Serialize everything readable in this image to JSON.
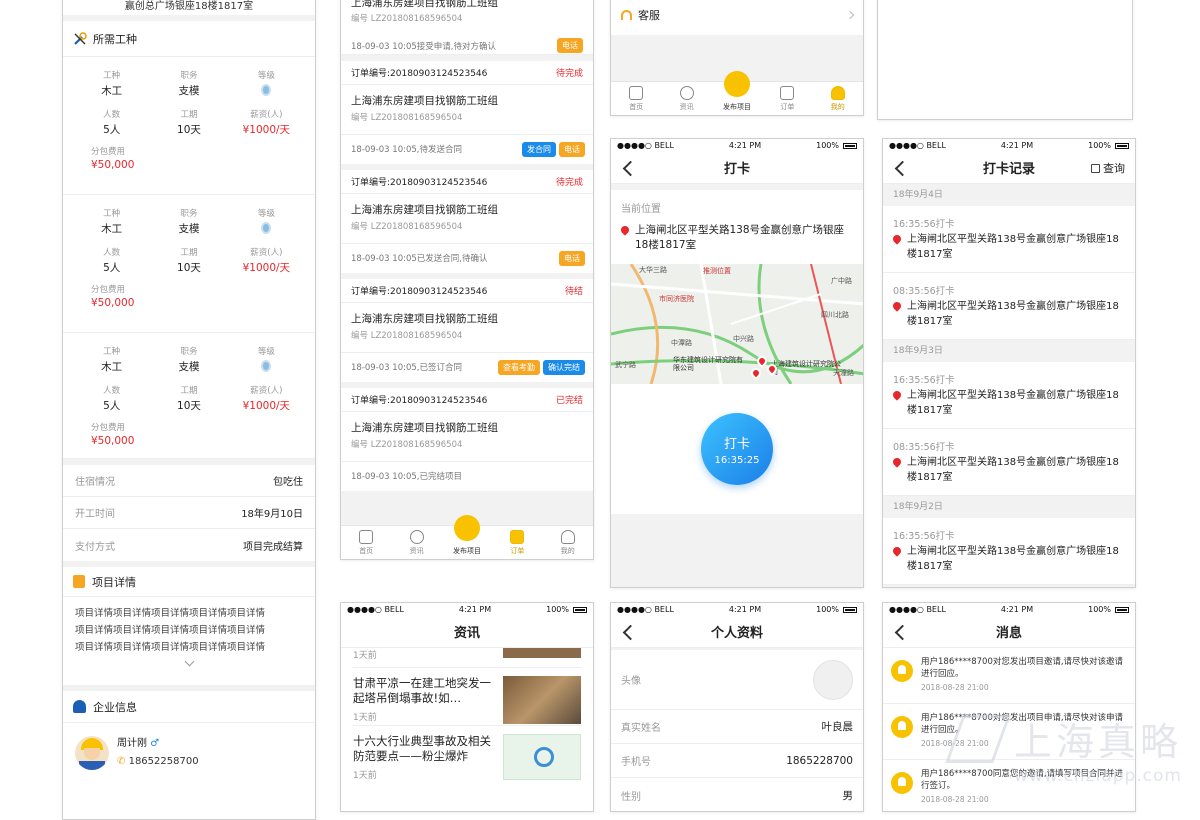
{
  "p1": {
    "top_text": "赢创总广场银座18楼1817室",
    "section1_title": "所需工种",
    "labels": {
      "type": "工种",
      "pos": "职务",
      "level": "等级",
      "people": "人数",
      "period": "工期",
      "salary": "薪资(人)",
      "sub_fee": "分包费用"
    },
    "groups": [
      {
        "type": "木工",
        "pos": "支模",
        "people": "5人",
        "period": "10天",
        "salary": "¥1000/天",
        "fee": "¥50,000"
      },
      {
        "type": "木工",
        "pos": "支模",
        "people": "5人",
        "period": "10天",
        "salary": "¥1000/天",
        "fee": "¥50,000"
      },
      {
        "type": "木工",
        "pos": "支模",
        "people": "5人",
        "period": "10天",
        "salary": "¥1000/天",
        "fee": "¥50,000"
      }
    ],
    "info": [
      {
        "k": "住宿情况",
        "v": "包吃住"
      },
      {
        "k": "开工时间",
        "v": "18年9月10日"
      },
      {
        "k": "支付方式",
        "v": "项目完成结算"
      }
    ],
    "detail_title": "项目详情",
    "detail_lines": [
      "项目详情项目详情项目详情项目详情项目详情",
      "项目详情项目详情项目详情项目详情项目详情",
      "项目详情项目详情项目详情项目详情项目详情"
    ],
    "company_title": "企业信息",
    "person_name": "周计刚",
    "gender_icon": "♂",
    "person_phone": "18652258700"
  },
  "p2": {
    "title_text": "上海浦东房建项目找钢筋工班组",
    "code_text": "编号 LZ201808168596504",
    "top_status": "18-09-03 10:05接受申请,待对方确认",
    "top_btn": "电话",
    "orders": [
      {
        "no": "订单编号:20180903124523546",
        "state": "待完成",
        "title": "上海浦东房建项目找钢筋工班组",
        "code": "编号 LZ201808168596504",
        "status": "18-09-03 10:05,待发送合同",
        "btns": [
          {
            "t": "发合同",
            "c": "bb"
          },
          {
            "t": "电话",
            "c": "by"
          }
        ]
      },
      {
        "no": "订单编号:20180903124523546",
        "state": "待完成",
        "title": "上海浦东房建项目找钢筋工班组",
        "code": "编号 LZ201808168596504",
        "status": "18-09-03 10:05已发送合同,待确认",
        "btns": [
          {
            "t": "电话",
            "c": "by"
          }
        ]
      },
      {
        "no": "订单编号:20180903124523546",
        "state": "待结",
        "title": "上海浦东房建项目找钢筋工班组",
        "code": "编号 LZ201808168596504",
        "status": "18-09-03 10:05,已签订合同",
        "btns": [
          {
            "t": "查看考勤",
            "c": "by"
          },
          {
            "t": "确认完结",
            "c": "bb"
          }
        ]
      },
      {
        "no": "订单编号:20180903124523546",
        "state": "已完结",
        "title": "上海浦东房建项目找钢筋工班组",
        "code": "编号 LZ201808168596504",
        "status": "18-09-03 10:05,已完结项目",
        "btns": []
      }
    ],
    "tabs": [
      "首页",
      "资讯",
      "发布项目",
      "订单",
      "我的"
    ]
  },
  "p3": {
    "kefu": "客服",
    "tabs": [
      "首页",
      "资讯",
      "发布项目",
      "订单",
      "我的"
    ]
  },
  "status": {
    "carrier": "●●●●○ BELL",
    "time": "4:21 PM",
    "battery": "100%"
  },
  "p4": {
    "title": "打卡",
    "loc_label": "当前位置",
    "address": "上海闸北区平型关路138号金赢创意广场银座18楼1817室",
    "map_labels": [
      "推测位置",
      "市同济医院",
      "中潭路",
      "华东建筑设计研究院有限公司",
      "上海建筑设计研究院公司",
      "四川北路",
      "天潼路",
      "中兴路",
      "大华三路",
      "广中路",
      "武宁路"
    ],
    "btn_label": "打卡",
    "btn_time": "16:35:25"
  },
  "p5": {
    "title": "打卡记录",
    "query": "查询",
    "days": [
      {
        "date": "18年9月4日",
        "items": [
          {
            "time": "16:35:56打卡",
            "addr": "上海闸北区平型关路138号金赢创意广场银座18楼1817室"
          },
          {
            "time": "08:35:56打卡",
            "addr": "上海闸北区平型关路138号金赢创意广场银座18楼1817室"
          }
        ]
      },
      {
        "date": "18年9月3日",
        "items": [
          {
            "time": "16:35:56打卡",
            "addr": "上海闸北区平型关路138号金赢创意广场银座18楼1817室"
          },
          {
            "time": "08:35:56打卡",
            "addr": "上海闸北区平型关路138号金赢创意广场银座18楼1817室"
          }
        ]
      },
      {
        "date": "18年9月2日",
        "items": [
          {
            "time": "16:35:56打卡",
            "addr": "上海闸北区平型关路138号金赢创意广场银座18楼1817室"
          }
        ]
      }
    ]
  },
  "p6": {
    "title": "资讯",
    "items": [
      {
        "title": "",
        "meta": "1天前"
      },
      {
        "title": "甘肃平凉一在建工地突发一起塔吊倒塌事故!如…",
        "meta": "1天前"
      },
      {
        "title": "十六大行业典型事故及相关防范要点——粉尘爆炸",
        "meta": "1天前"
      }
    ]
  },
  "p7": {
    "title": "个人资料",
    "rows": [
      {
        "k": "头像",
        "v": ""
      },
      {
        "k": "真实姓名",
        "v": "叶良晨"
      },
      {
        "k": "手机号",
        "v": "1865228700"
      },
      {
        "k": "性别",
        "v": "男"
      }
    ]
  },
  "p8": {
    "title": "消息",
    "items": [
      {
        "text": "用户186****8700对您发出项目邀请,请尽快对该邀请进行回应。",
        "time": "2018-08-28  21:00"
      },
      {
        "text": "用户186****8700对您发出项目申请,请尽快对该申请进行回应。",
        "time": "2018-08-28  21:00"
      },
      {
        "text": "用户186****8700同意您的邀请,请填写项目合同并进行签订。",
        "time": "2018-08-28  21:00"
      }
    ]
  },
  "watermark": {
    "big": "上海真略",
    "small": "www.chzlapp.com"
  },
  "colors": {
    "accent": "#f8c200",
    "red": "#e8262b",
    "blue": "#1a8be8",
    "orange": "#f6a623"
  }
}
